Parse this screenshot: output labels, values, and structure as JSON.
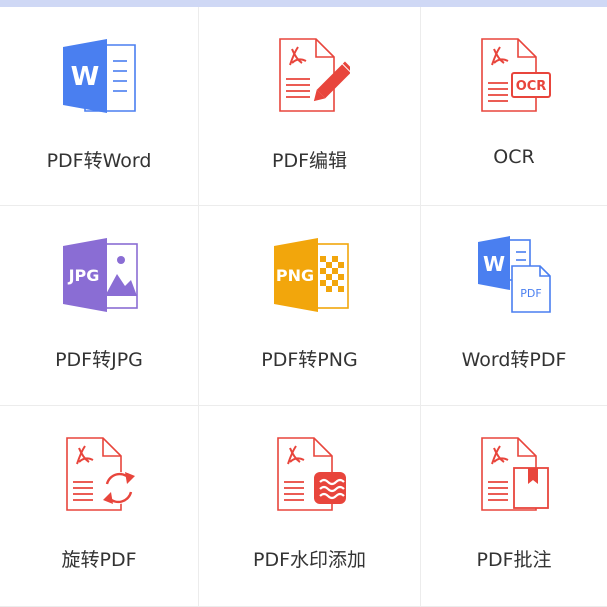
{
  "colors": {
    "pdf_red": "#e8453c",
    "word_blue": "#4a7ff0",
    "jpg_purple": "#8a6dd4",
    "png_orange": "#f2a60c"
  },
  "tools": [
    {
      "label": "PDF转Word",
      "icon": "pdf-to-word-icon"
    },
    {
      "label": "PDF编辑",
      "icon": "pdf-edit-icon"
    },
    {
      "label": "OCR",
      "icon": "ocr-icon"
    },
    {
      "label": "PDF转JPG",
      "icon": "pdf-to-jpg-icon"
    },
    {
      "label": "PDF转PNG",
      "icon": "pdf-to-png-icon"
    },
    {
      "label": "Word转PDF",
      "icon": "word-to-pdf-icon"
    },
    {
      "label": "旋转PDF",
      "icon": "rotate-pdf-icon"
    },
    {
      "label": "PDF水印添加",
      "icon": "pdf-watermark-icon"
    },
    {
      "label": "PDF批注",
      "icon": "pdf-annotate-icon"
    }
  ]
}
